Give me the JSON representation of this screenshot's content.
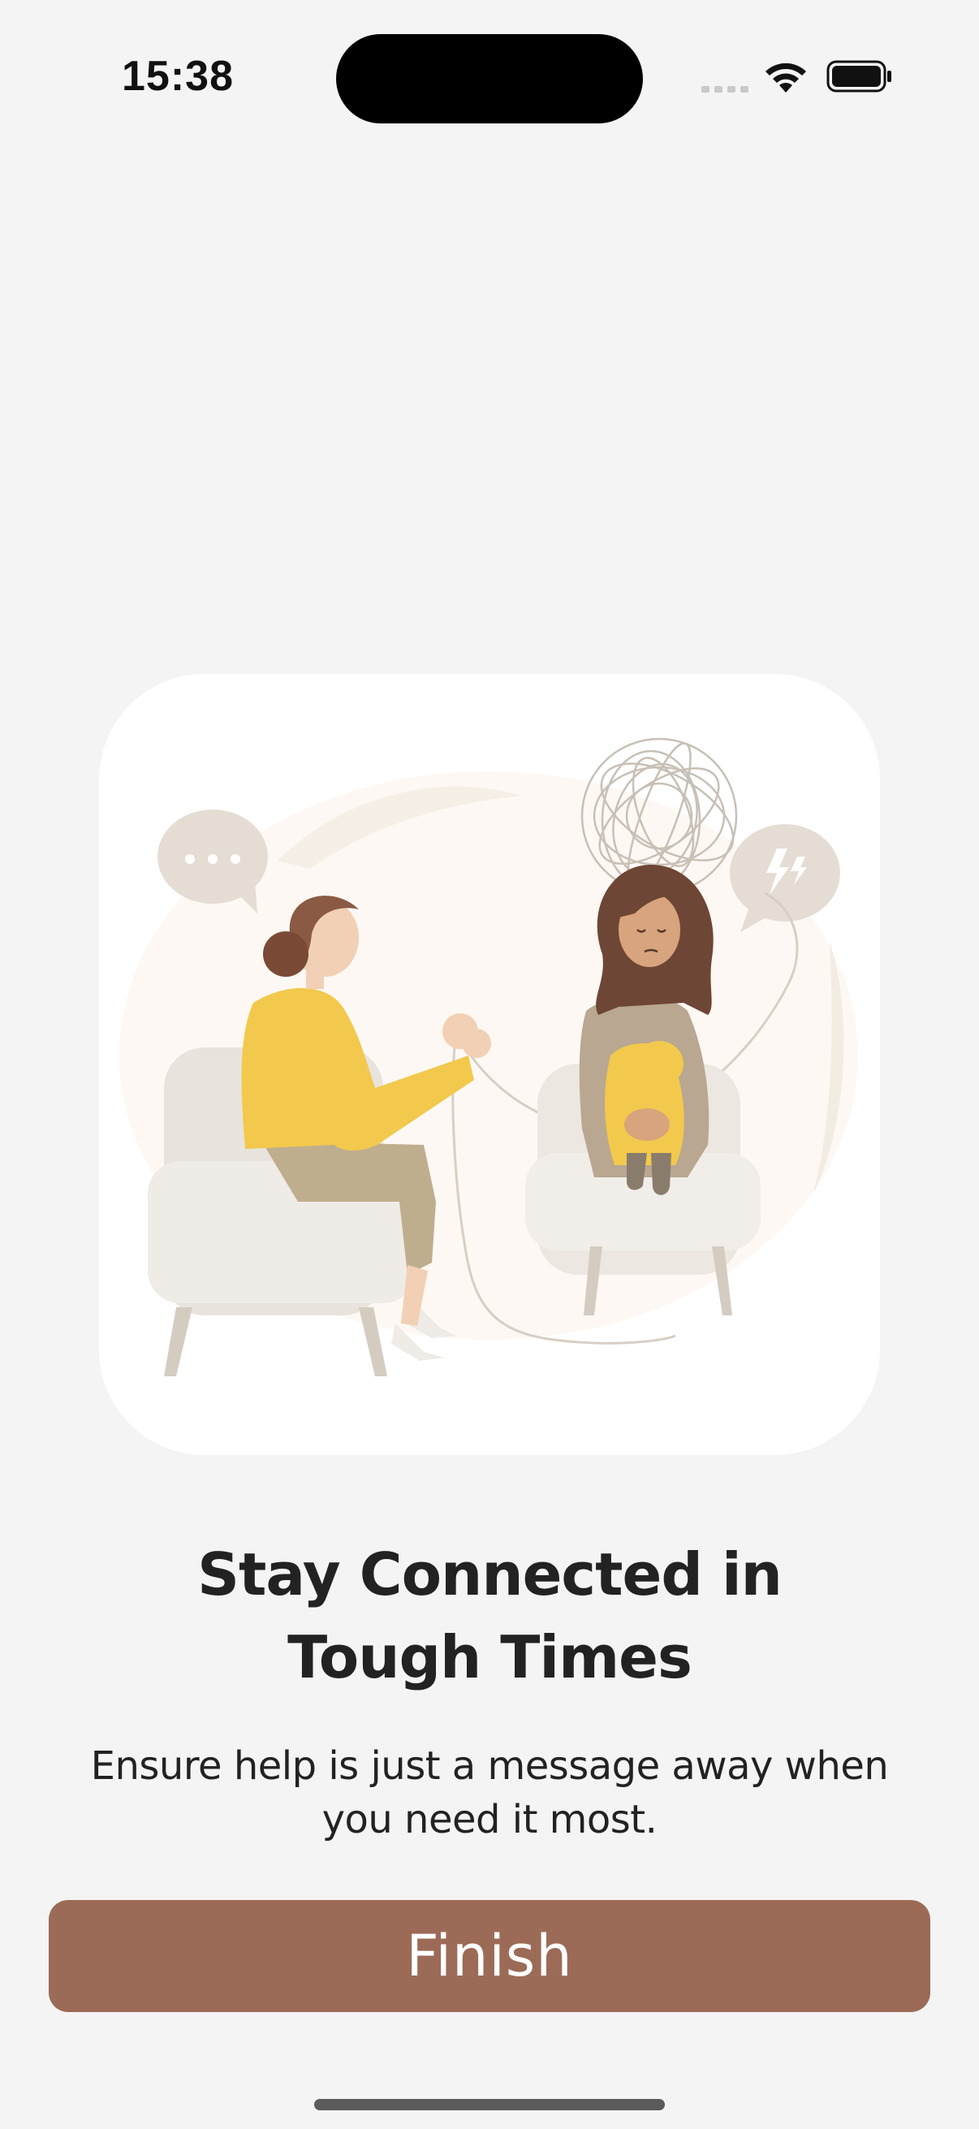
{
  "status_bar": {
    "time": "15:38",
    "icons": [
      "signal-icon",
      "wifi-icon",
      "battery-icon"
    ]
  },
  "illustration": {
    "description_icon": "therapy-session-illustration",
    "speech_bubble_left": "ellipsis",
    "speech_bubble_right": "lightning"
  },
  "onboarding": {
    "title_line1": "Stay Connected in",
    "title_line2": "Tough Times",
    "subtitle_line1": "Ensure help is just a message away when",
    "subtitle_line2": "you need it most.",
    "finish_label": "Finish"
  },
  "colors": {
    "background": "#f4f4f4",
    "button": "#9c6b57",
    "button_text": "#ffffff",
    "accent_yellow": "#f2c94c"
  }
}
